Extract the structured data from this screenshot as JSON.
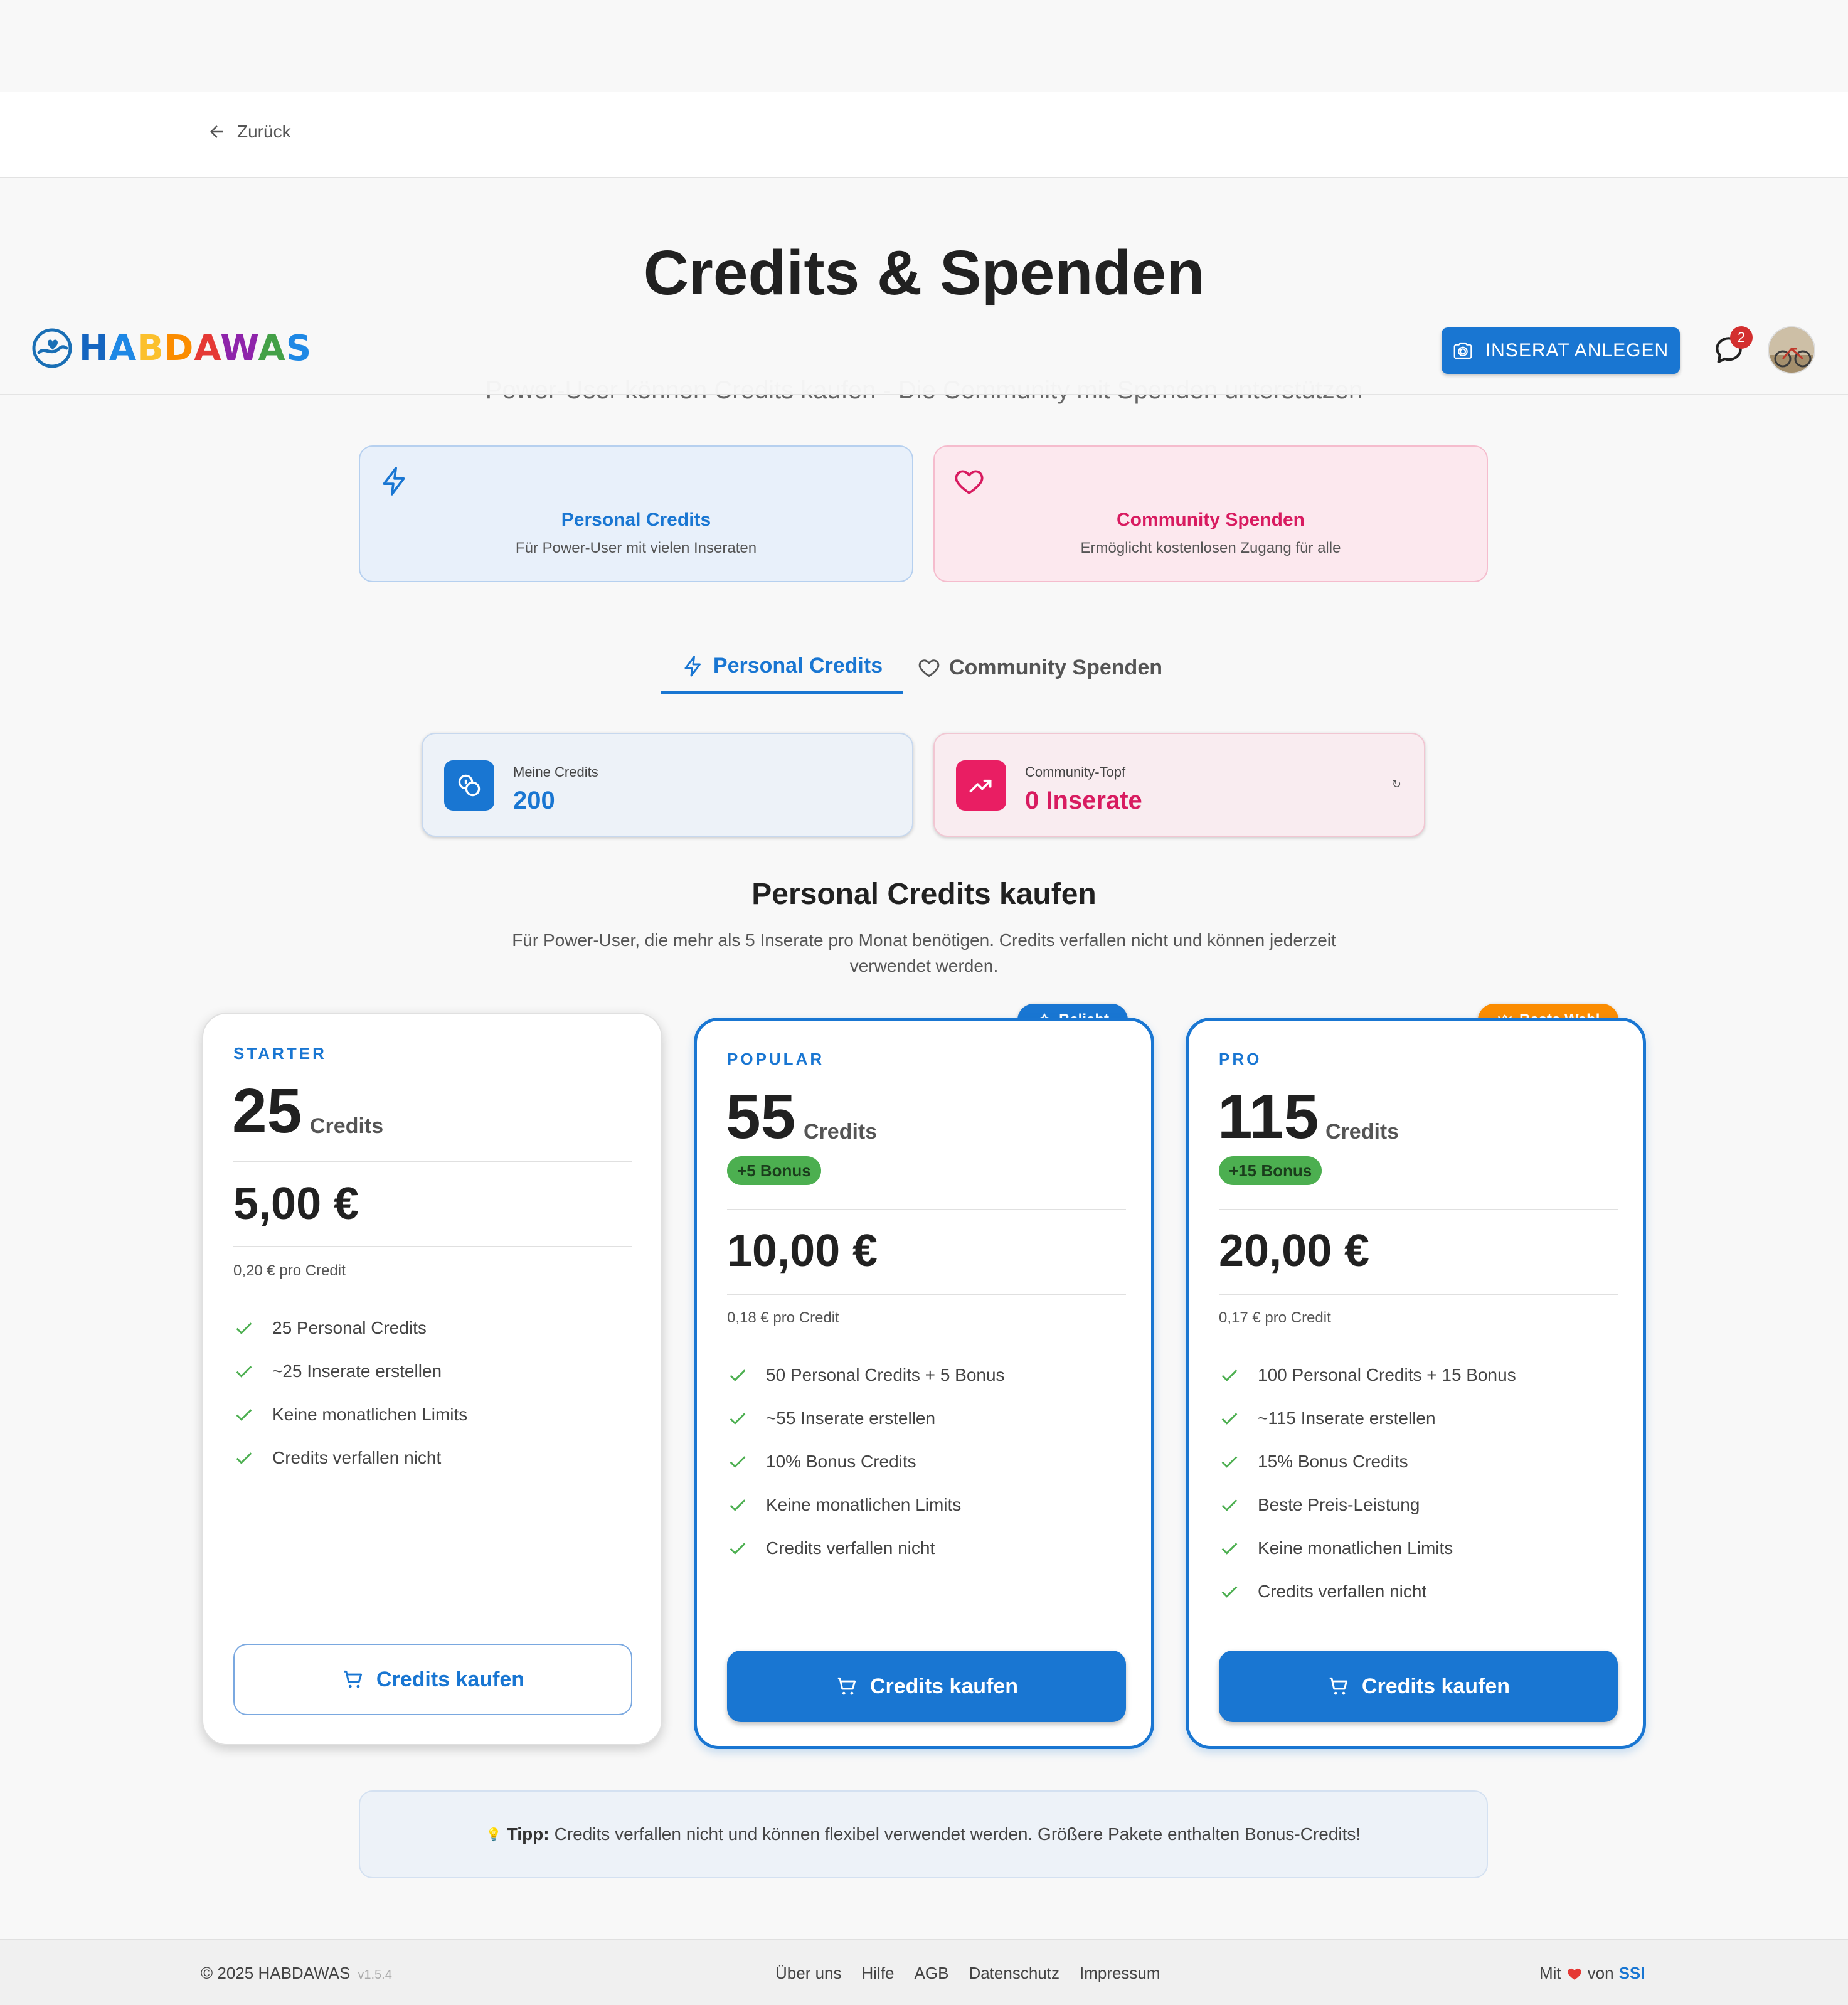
{
  "back": {
    "label": "Zurück"
  },
  "header": {
    "title": "Credits & Spenden",
    "subtitle": "Power-User können Credits kaufen - Die Community mit Spenden unterstützen"
  },
  "appbar": {
    "logo": {
      "parts": [
        "H",
        "A",
        "B",
        "D",
        "A",
        "W",
        "A",
        "S"
      ]
    },
    "create_button": "INSERAT ANLEGEN",
    "chat_badge": "2"
  },
  "modes": {
    "personal": {
      "title": "Personal Credits",
      "desc": "Für Power-User mit vielen Inseraten"
    },
    "community": {
      "title": "Community Spenden",
      "desc": "Ermöglicht kostenlosen Zugang für alle"
    }
  },
  "tabs": [
    {
      "label": "Personal Credits",
      "active": true
    },
    {
      "label": "Community Spenden",
      "active": false
    }
  ],
  "stats": {
    "credits": {
      "label": "Meine Credits",
      "value": "200"
    },
    "pot": {
      "label": "Community-Topf",
      "value": "0 Inserate",
      "refresh": "↻"
    }
  },
  "section": {
    "title": "Personal Credits kaufen",
    "desc": "Für Power-User, die mehr als 5 Inserate pro Monat benötigen. Credits verfallen nicht und können jederzeit verwendet werden."
  },
  "plans": [
    {
      "tier": "STARTER",
      "amount": "25",
      "unit": "Credits",
      "bonus": "",
      "price": "5,00 €",
      "per": "0,20 € pro Credit",
      "features": [
        "25 Personal Credits",
        "~25 Inserate erstellen",
        "Keine monatlichen Limits",
        "Credits verfallen nicht"
      ],
      "button": "Credits kaufen"
    },
    {
      "tier": "POPULAR",
      "amount": "55",
      "unit": "Credits",
      "bonus": "+5 Bonus",
      "price": "10,00 €",
      "per": "0,18 € pro Credit",
      "ribbon": "Beliebt",
      "features": [
        "50 Personal Credits + 5 Bonus",
        "~55 Inserate erstellen",
        "10% Bonus Credits",
        "Keine monatlichen Limits",
        "Credits verfallen nicht"
      ],
      "button": "Credits kaufen"
    },
    {
      "tier": "PRO",
      "amount": "115",
      "unit": "Credits",
      "bonus": "+15 Bonus",
      "price": "20,00 €",
      "per": "0,17 € pro Credit",
      "ribbon": "Beste Wahl",
      "features": [
        "100 Personal Credits + 15 Bonus",
        "~115 Inserate erstellen",
        "15% Bonus Credits",
        "Beste Preis-Leistung",
        "Keine monatlichen Limits",
        "Credits verfallen nicht"
      ],
      "button": "Credits kaufen"
    }
  ],
  "tip": {
    "icon": "💡",
    "label": "Tipp:",
    "text": "Credits verfallen nicht und können flexibel verwendet werden. Größere Pakete enthalten Bonus-Credits!"
  },
  "footer": {
    "copyright": "© 2025 HABDAWAS",
    "version": "v1.5.4",
    "links": [
      "Über uns",
      "Hilfe",
      "AGB",
      "Datenschutz",
      "Impressum"
    ],
    "made_with": "Mit",
    "by": "von",
    "brand": "SSI"
  },
  "colors": {
    "primary": "#1976d2",
    "pink": "#e91e63",
    "green": "#4caf50",
    "orange": "#fb8c00"
  }
}
